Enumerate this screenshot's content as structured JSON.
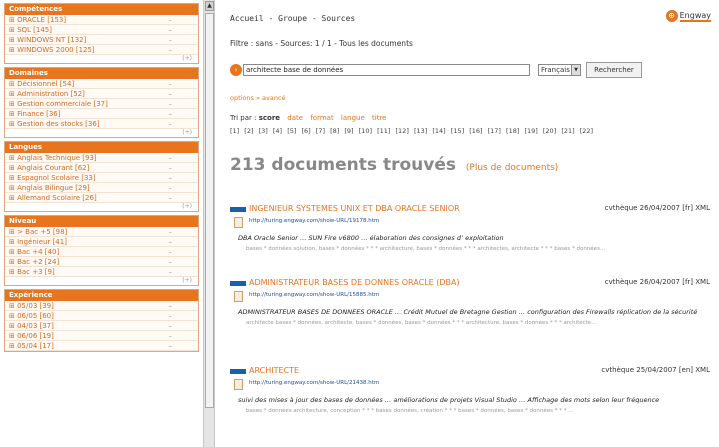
{
  "sidebar": {
    "facets": [
      {
        "title": "Compétences",
        "items": [
          {
            "label": "ORACLE [153]"
          },
          {
            "label": "SQL [145]"
          },
          {
            "label": "WINDOWS NT [132]"
          },
          {
            "label": "WINDOWS 2000 [125]"
          }
        ],
        "more": "(+)"
      },
      {
        "title": "Domaines",
        "items": [
          {
            "label": "Décisionnel [54]"
          },
          {
            "label": "Administration [52]"
          },
          {
            "label": "Gestion commerciale [37]"
          },
          {
            "label": "Finance [36]"
          },
          {
            "label": "Gestion des stocks [36]"
          }
        ],
        "more": "(+)"
      },
      {
        "title": "Langues",
        "items": [
          {
            "label": "Anglais Technique [93]"
          },
          {
            "label": "Anglais Courant [62]"
          },
          {
            "label": "Espagnol Scolaire [33]"
          },
          {
            "label": "Anglais Bilingue [29]"
          },
          {
            "label": "Allemand Scolaire [26]"
          }
        ],
        "more": "(+)"
      },
      {
        "title": "Niveau",
        "items": [
          {
            "label": "> Bac +5 [98]"
          },
          {
            "label": "Ingénieur [41]"
          },
          {
            "label": "Bac +4 [40]"
          },
          {
            "label": "Bac +2 [24]"
          },
          {
            "label": "Bac +3 [9]"
          }
        ],
        "more": "(+)"
      },
      {
        "title": "Expérience",
        "items": [
          {
            "label": "05/03 [39]"
          },
          {
            "label": "06/05 [60]"
          },
          {
            "label": "04/03 [37]"
          },
          {
            "label": "06/06 [19]"
          },
          {
            "label": "05/04 [17]"
          }
        ],
        "more": ""
      }
    ],
    "minus_symbol": "–"
  },
  "scrollbar": {
    "up_arrow": "▲"
  },
  "header": {
    "breadcrumb": "Accueil - Groupe - Sources",
    "logo_mark": "⊕",
    "logo_text": "Engway",
    "filter_text": "Filtre : sans -  Sources: 1 / 1  - Tous les documents"
  },
  "search": {
    "go_icon": "›",
    "query": "architecte base de données",
    "language": "Français",
    "select_arrow": "▼",
    "button_label": "Rechercher"
  },
  "options_link": "options » avancé",
  "sort": {
    "prefix": "Tri par :",
    "selected": "score",
    "options": [
      "date",
      "format",
      "langue",
      "titre"
    ]
  },
  "pagination": [
    "[1]",
    "[2]",
    "[3]",
    "[4]",
    "[5]",
    "[6]",
    "[7]",
    "[8]",
    "[9]",
    "[10]",
    "[11]",
    "[12]",
    "[13]",
    "[14]",
    "[15]",
    "[16]",
    "[17]",
    "[18]",
    "[19]",
    "[20]",
    "[21]",
    "[22]"
  ],
  "results_count": "213 documents trouvés",
  "more_docs": "(Plus de documents)",
  "results": [
    {
      "title": "INGENIEUR SYSTEMES UNIX ET DBA ORACLE SENIOR",
      "meta": "cvthèque  26/04/2007  [fr]  XML",
      "url": "http://turing.engway.com/show-URL/19178.htm",
      "snippet": "DBA Oracle Senior … SUN Fire v6800 … élaboration des consignes d’ exploitation",
      "keywords": "bases * données solution, bases * données * * * architecture, bases * données * * * architectes, architecte * * * bases * données…"
    },
    {
      "title": "ADMINISTRATEUR BASES DE DONNES ORACLE (DBA)",
      "meta": "cvthèque  26/04/2007  [fr]  XML",
      "url": "http://turing.engway.com/show-URL/15885.htm",
      "snippet": "ADMINISTRATEUR BASES DE DONNEES ORACLE … Crédit Mutuel de Bretagne Gestion … configuration des Firewalls réplication de la sécurité",
      "keywords": "architecte bases * données, architecte, bases * données, bases * données * * * architecture, bases * données * * * architecte…"
    },
    {
      "title": "ARCHITECTE",
      "meta": "cvthèque  25/04/2007  [en]  XML",
      "url": "http://turing.engway.com/show-URL/21438.htm",
      "snippet": "suivi des mises à jour des bases de données … améliorations de projets Visual Studio … Affichage des mots selon leur fréquence",
      "keywords": "bases * données architecture, conception * * * bases données, création * * * bases * données, bases * données * * * …"
    }
  ]
}
